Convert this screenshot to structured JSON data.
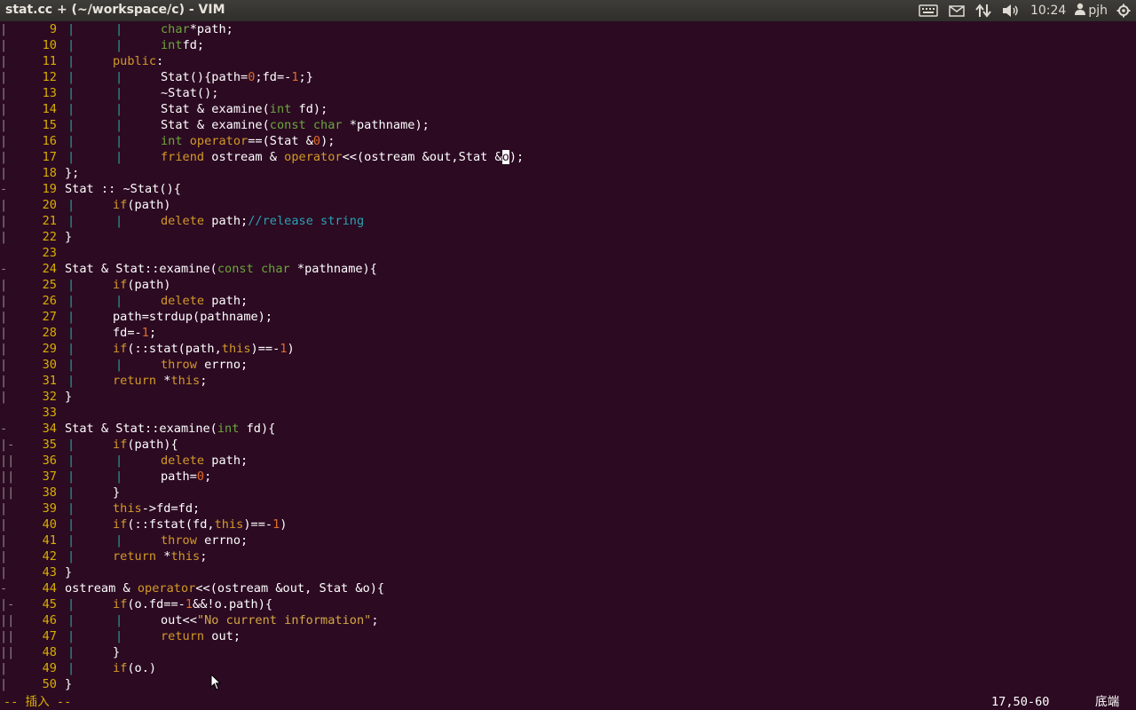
{
  "window": {
    "title": "stat.cc + (~/workspace/c) - VIM"
  },
  "panel": {
    "icons": [
      "keyboard-icon",
      "mail-icon",
      "network-icon",
      "volume-icon",
      "power-gear-icon"
    ],
    "clock": "10:24",
    "user": "pjh"
  },
  "lines": [
    {
      "fold": "|",
      "n": "9",
      "guides": 2,
      "code": [
        [
          "ty",
          "char"
        ],
        [
          "",
          "*path;"
        ]
      ]
    },
    {
      "fold": "|",
      "n": "10",
      "guides": 2,
      "code": [
        [
          "ty",
          "int"
        ],
        [
          "",
          "fd;"
        ]
      ]
    },
    {
      "fold": "|",
      "n": "11",
      "guides": 1,
      "code": [
        [
          "kw",
          "public"
        ],
        [
          "",
          ":"
        ]
      ]
    },
    {
      "fold": "|",
      "n": "12",
      "guides": 2,
      "code": [
        [
          "",
          "Stat(){path="
        ],
        [
          "num",
          "0"
        ],
        [
          "",
          ";fd=-"
        ],
        [
          "num",
          "1"
        ],
        [
          "",
          ";}"
        ]
      ]
    },
    {
      "fold": "|",
      "n": "13",
      "guides": 2,
      "code": [
        [
          "",
          "~Stat();"
        ]
      ]
    },
    {
      "fold": "|",
      "n": "14",
      "guides": 2,
      "code": [
        [
          "",
          "Stat & examine("
        ],
        [
          "ty",
          "int"
        ],
        [
          "",
          " fd);"
        ]
      ]
    },
    {
      "fold": "|",
      "n": "15",
      "guides": 2,
      "code": [
        [
          "",
          "Stat & examine("
        ],
        [
          "ty",
          "const char"
        ],
        [
          "",
          " *pathname);"
        ]
      ]
    },
    {
      "fold": "|",
      "n": "16",
      "guides": 2,
      "code": [
        [
          "ty",
          "int"
        ],
        [
          "",
          " "
        ],
        [
          "kw",
          "operator"
        ],
        [
          "",
          "==(Stat &"
        ],
        [
          "num",
          "0"
        ],
        [
          "",
          ");"
        ]
      ]
    },
    {
      "fold": "|",
      "n": "17",
      "guides": 2,
      "code": [
        [
          "kw",
          "friend"
        ],
        [
          "",
          " ostream & "
        ],
        [
          "kw",
          "operator"
        ],
        [
          "",
          "<<(ostream &out,Stat &"
        ],
        [
          "cursor",
          "o"
        ],
        [
          "",
          ");"
        ]
      ]
    },
    {
      "fold": "|",
      "n": "18",
      "guides": 0,
      "code": [
        [
          "",
          "};"
        ]
      ]
    },
    {
      "fold": "-",
      "n": "19",
      "guides": 0,
      "code": [
        [
          "",
          "Stat :: ~Stat(){"
        ]
      ]
    },
    {
      "fold": "|",
      "n": "20",
      "guides": 1,
      "code": [
        [
          "kw",
          "if"
        ],
        [
          "",
          "(path)"
        ]
      ]
    },
    {
      "fold": "|",
      "n": "21",
      "guides": 2,
      "code": [
        [
          "kw",
          "delete"
        ],
        [
          "",
          " path;"
        ],
        [
          "cmt",
          "//release string"
        ]
      ]
    },
    {
      "fold": "|",
      "n": "22",
      "guides": 0,
      "code": [
        [
          "",
          "}"
        ]
      ]
    },
    {
      "fold": "",
      "n": "23",
      "guides": 0,
      "code": []
    },
    {
      "fold": "-",
      "n": "24",
      "guides": 0,
      "code": [
        [
          "",
          "Stat & Stat::examine("
        ],
        [
          "ty",
          "const char"
        ],
        [
          "",
          " *pathname){"
        ]
      ]
    },
    {
      "fold": "|",
      "n": "25",
      "guides": 1,
      "code": [
        [
          "kw",
          "if"
        ],
        [
          "",
          "(path)"
        ]
      ]
    },
    {
      "fold": "|",
      "n": "26",
      "guides": 2,
      "code": [
        [
          "kw",
          "delete"
        ],
        [
          "",
          " path;"
        ]
      ]
    },
    {
      "fold": "|",
      "n": "27",
      "guides": 1,
      "code": [
        [
          "",
          "path=strdup(pathname);"
        ]
      ]
    },
    {
      "fold": "|",
      "n": "28",
      "guides": 1,
      "code": [
        [
          "",
          "fd=-"
        ],
        [
          "num",
          "1"
        ],
        [
          "",
          ";"
        ]
      ]
    },
    {
      "fold": "|",
      "n": "29",
      "guides": 1,
      "code": [
        [
          "kw",
          "if"
        ],
        [
          "",
          "(::stat(path,"
        ],
        [
          "kw",
          "this"
        ],
        [
          "",
          ")==-"
        ],
        [
          "num",
          "1"
        ],
        [
          "",
          ")"
        ]
      ]
    },
    {
      "fold": "|",
      "n": "30",
      "guides": 2,
      "code": [
        [
          "kw",
          "throw"
        ],
        [
          "",
          " errno;"
        ]
      ]
    },
    {
      "fold": "|",
      "n": "31",
      "guides": 1,
      "code": [
        [
          "kw",
          "return"
        ],
        [
          "",
          " *"
        ],
        [
          "kw",
          "this"
        ],
        [
          "",
          ";"
        ]
      ]
    },
    {
      "fold": "|",
      "n": "32",
      "guides": 0,
      "code": [
        [
          "",
          "}"
        ]
      ]
    },
    {
      "fold": "",
      "n": "33",
      "guides": 0,
      "code": []
    },
    {
      "fold": "-",
      "n": "34",
      "guides": 0,
      "code": [
        [
          "",
          "Stat & Stat::examine("
        ],
        [
          "ty",
          "int"
        ],
        [
          "",
          " fd){"
        ]
      ]
    },
    {
      "fold": "|-",
      "n": "35",
      "guides": 1,
      "code": [
        [
          "kw",
          "if"
        ],
        [
          "",
          "(path){"
        ]
      ]
    },
    {
      "fold": "||",
      "n": "36",
      "guides": 2,
      "code": [
        [
          "kw",
          "delete"
        ],
        [
          "",
          " path;"
        ]
      ]
    },
    {
      "fold": "||",
      "n": "37",
      "guides": 2,
      "code": [
        [
          "",
          "path="
        ],
        [
          "num",
          "0"
        ],
        [
          "",
          ";"
        ]
      ]
    },
    {
      "fold": "||",
      "n": "38",
      "guides": 1,
      "code": [
        [
          "",
          "}"
        ]
      ]
    },
    {
      "fold": "|",
      "n": "39",
      "guides": 1,
      "code": [
        [
          "kw",
          "this"
        ],
        [
          "",
          "->fd=fd;"
        ]
      ]
    },
    {
      "fold": "|",
      "n": "40",
      "guides": 1,
      "code": [
        [
          "kw",
          "if"
        ],
        [
          "",
          "(::fstat(fd,"
        ],
        [
          "kw",
          "this"
        ],
        [
          "",
          ")==-"
        ],
        [
          "num",
          "1"
        ],
        [
          "",
          ")"
        ]
      ]
    },
    {
      "fold": "|",
      "n": "41",
      "guides": 2,
      "code": [
        [
          "kw",
          "throw"
        ],
        [
          "",
          " errno;"
        ]
      ]
    },
    {
      "fold": "|",
      "n": "42",
      "guides": 1,
      "code": [
        [
          "kw",
          "return"
        ],
        [
          "",
          " *"
        ],
        [
          "kw",
          "this"
        ],
        [
          "",
          ";"
        ]
      ]
    },
    {
      "fold": "|",
      "n": "43",
      "guides": 0,
      "code": [
        [
          "",
          "}"
        ]
      ]
    },
    {
      "fold": "-",
      "n": "44",
      "guides": 0,
      "code": [
        [
          "",
          "ostream & "
        ],
        [
          "kw",
          "operator"
        ],
        [
          "",
          "<<(ostream &out, Stat &o){"
        ]
      ]
    },
    {
      "fold": "|-",
      "n": "45",
      "guides": 1,
      "code": [
        [
          "kw",
          "if"
        ],
        [
          "",
          "(o.fd==-"
        ],
        [
          "num",
          "1"
        ],
        [
          "",
          "&&!o.path){"
        ]
      ]
    },
    {
      "fold": "||",
      "n": "46",
      "guides": 2,
      "code": [
        [
          "",
          "out<<"
        ],
        [
          "str",
          "\"No current information\""
        ],
        [
          "",
          ";"
        ]
      ]
    },
    {
      "fold": "||",
      "n": "47",
      "guides": 2,
      "code": [
        [
          "kw",
          "return"
        ],
        [
          "",
          " out;"
        ]
      ]
    },
    {
      "fold": "||",
      "n": "48",
      "guides": 1,
      "code": [
        [
          "",
          "}"
        ]
      ]
    },
    {
      "fold": "|",
      "n": "49",
      "guides": 1,
      "code": [
        [
          "kw",
          "if"
        ],
        [
          "",
          "(o.)"
        ]
      ]
    },
    {
      "fold": "|",
      "n": "50",
      "guides": 0,
      "code": [
        [
          "",
          "}"
        ]
      ]
    }
  ],
  "status": {
    "mode": "-- 插入 --",
    "position": "17,50-60",
    "scroll": "底端"
  }
}
